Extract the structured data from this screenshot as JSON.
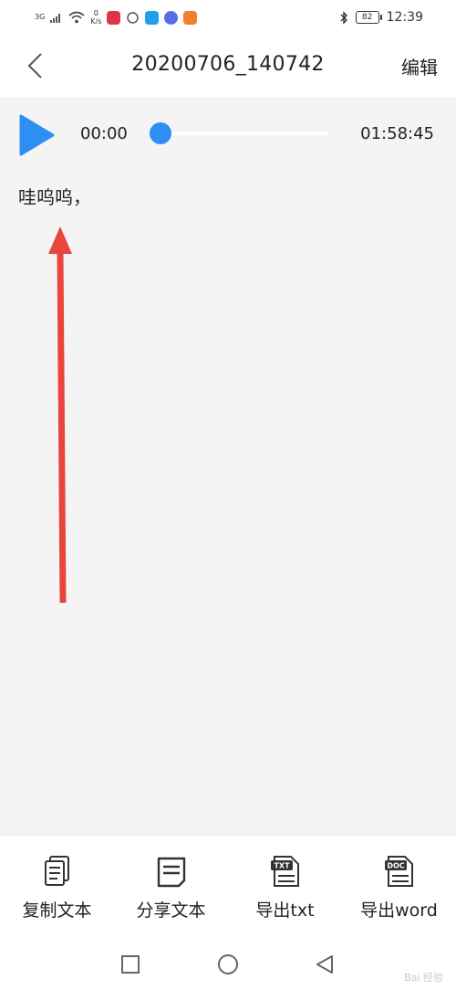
{
  "status_bar": {
    "network_label": "3G",
    "speed_value": "0",
    "speed_unit": "K/s",
    "battery": "82",
    "time": "12:39"
  },
  "header": {
    "title": "20200706_140742",
    "edit_label": "编辑"
  },
  "player": {
    "current_time": "00:00",
    "total_time": "01:58:45",
    "progress": 0,
    "accent_color": "#2f8ef4"
  },
  "transcript": {
    "text": "哇呜呜，"
  },
  "annotation": {
    "arrow_color": "#e8453c"
  },
  "toolbar": {
    "items": [
      {
        "label": "复制文本",
        "icon": "copy-text-icon"
      },
      {
        "label": "分享文本",
        "icon": "share-text-icon"
      },
      {
        "label": "导出txt",
        "icon": "export-txt-icon",
        "badge": "TXT"
      },
      {
        "label": "导出word",
        "icon": "export-word-icon",
        "badge": "DOC"
      }
    ]
  },
  "navbar": {
    "watermark": "Bai 经验"
  }
}
